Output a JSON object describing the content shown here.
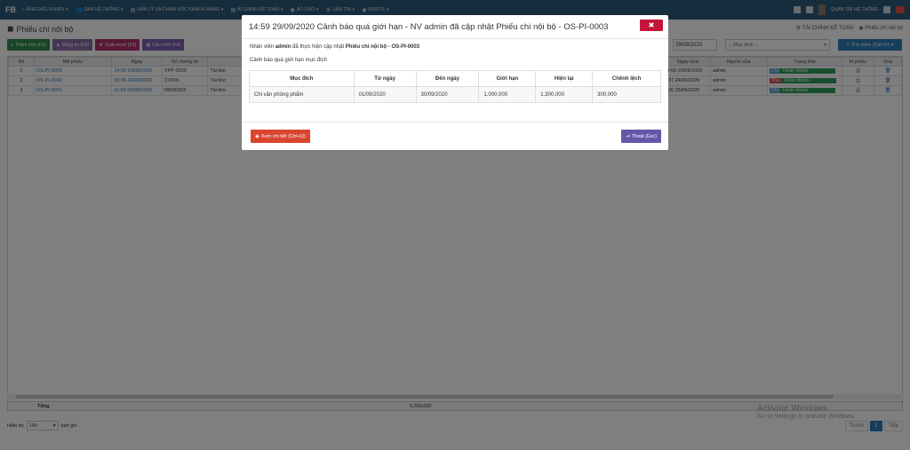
{
  "app": {
    "logo": "FB"
  },
  "nav": {
    "items": [
      {
        "icon": "dashboard-icon",
        "glyph": "⌂",
        "label": "ĂNG ĐIỀU KHIỂN"
      },
      {
        "icon": "users-icon",
        "glyph": "👥",
        "label": "ỌAN HỆ THỐNG"
      },
      {
        "icon": "file-icon",
        "glyph": "▤",
        "label": "UẢN LÝ VÀ CHĂM SÓC KHÁCH HÀNG"
      },
      {
        "icon": "doc-icon",
        "glyph": "▤",
        "label": "ÀI CHÍNH KẾ TOÁN"
      },
      {
        "icon": "globe-icon",
        "glyph": "◉",
        "label": "ÁO CÁO"
      },
      {
        "icon": "gear-icon",
        "glyph": "⚙",
        "label": "UẢN TRỊ"
      },
      {
        "icon": "globe-icon",
        "glyph": "◉",
        "label": "EBSITE"
      }
    ],
    "user_label": "QUẢN TRỊ HỆ THỐNG"
  },
  "page": {
    "title": "Phiếu chi nội bộ",
    "breadcrumbs": [
      "TÀI CHÍNH KẾ TOÁN",
      "Phiếu chi nội bộ"
    ]
  },
  "toolbar": {
    "add_label": "Thêm mới (F1)",
    "update_label": "Đăng tin (F2)",
    "excel_label": "Xuất excel (F3)",
    "config_label": "Cấu hình (F4)",
    "date_value": "29/09/2020",
    "purpose_placeholder": "-- Mục đích --",
    "search_label": "Tìm kiếm (Ctrl+F)"
  },
  "grid": {
    "columns": [
      "Stt",
      "Mã phiếu",
      "Ngày",
      "Số chứng từ",
      "",
      "Ngày sửa",
      "Người sửa",
      "Trạng thái",
      "In phiếu",
      "Xóa"
    ],
    "rows": [
      {
        "stt": "1",
        "code": "OS-PI-0003",
        "date": "14:59 29/09/2020",
        "doc": "VPP-2929",
        "desc": "Tài kho",
        "modified": "4:59 29/09/2020",
        "editor": "admin",
        "flag": "Chi",
        "status": "Hoàn thành"
      },
      {
        "stt": "2",
        "code": "OS-PI-0002",
        "date": "15:36 24/09/2020",
        "doc": "CVP01",
        "desc": "Tài kho",
        "modified": ":37 24/09/2020",
        "editor": "admin",
        "flag": "Thu",
        "status": "Hoàn thành"
      },
      {
        "stt": "3",
        "code": "OS-PI-0001",
        "date": "11:50 24/09/2020",
        "doc": "09030002",
        "desc": "Tài kho",
        "modified": ":26 25/09/2020",
        "editor": "admin",
        "flag": "Chi",
        "status": "Hoàn thành"
      }
    ],
    "total_label": "Tổng",
    "total_amount": "5,300,000"
  },
  "pager": {
    "show_label": "Hiển thị",
    "page_size": "100",
    "records_label": "bản ghi",
    "prev_label": "Trước",
    "current_page": "1",
    "next_label": "Tiếp"
  },
  "watermark": {
    "line1": "Activate Windows",
    "line2": "Go to Settings to activate Windows."
  },
  "modal": {
    "title": "14:59 29/09/2020 Cảnh báo quá giới hạn - NV admin đã cập nhật Phiếu chi nội bộ - OS-PI-0003",
    "line_prefix": "Nhân viên",
    "user": "admin",
    "line_mid": "đã thực hiện cập nhật",
    "doc_ref": "Phiếu chi nội bộ - OS-PI-0003",
    "subtitle": "Cảnh báo quá giới hạn mục đích",
    "columns": [
      "Mục đích",
      "Từ ngày",
      "Đến ngày",
      "Giới hạn",
      "Hiện tại",
      "Chênh lệch"
    ],
    "row": [
      "Chi văn phòng phẩm",
      "01/09/2020",
      "30/09/2020",
      "1,000,000",
      "1,300,000",
      "300,000"
    ],
    "detail_button": "Xem chi tiết (Ctrl+Q)",
    "exit_button": "Thoát (Esc)"
  }
}
